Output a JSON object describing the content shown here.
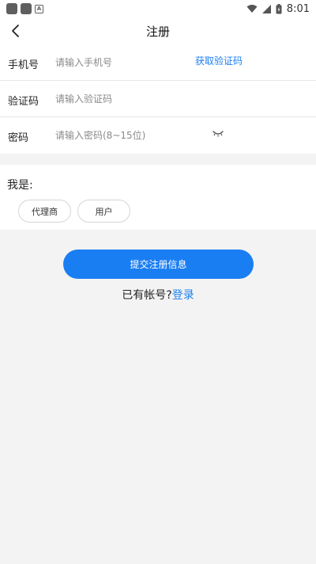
{
  "status_bar": {
    "time": "8:01"
  },
  "nav": {
    "title": "注册"
  },
  "form": {
    "phone": {
      "label": "手机号",
      "placeholder": "请输入手机号",
      "value": "",
      "action": "获取验证码"
    },
    "code": {
      "label": "验证码",
      "placeholder": "请输入验证码",
      "value": ""
    },
    "password": {
      "label": "密码",
      "placeholder": "请输入密码(8~15位)",
      "value": ""
    }
  },
  "role": {
    "label": "我是:",
    "options": [
      "代理商",
      "用户"
    ]
  },
  "submit_label": "提交注册信息",
  "login": {
    "prompt": "已有帐号?",
    "link": "登录"
  },
  "colors": {
    "accent": "#1a7ef3",
    "background": "#f3f3f3"
  },
  "icons": [
    "back-arrow-icon",
    "eye-closed-icon",
    "wifi-icon",
    "signal-icon",
    "battery-icon"
  ]
}
